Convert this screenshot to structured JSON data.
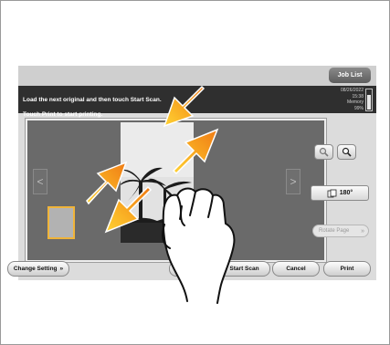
{
  "header": {
    "job_list": "Job List"
  },
  "message": {
    "line1": "Load the next original and then touch Start Scan.",
    "line2": "Touch Print to start printing."
  },
  "status": {
    "date": "08/26/2022",
    "time": "15:38",
    "memory_label": "Memory",
    "memory_value": "99%"
  },
  "preview": {
    "nav_prev": "<",
    "nav_next": ">"
  },
  "side": {
    "zoom_out_icon": "magnifier-minus-icon",
    "zoom_in_icon": "magnifier-plus-icon",
    "rotate_label": "180°",
    "rotate_page_label": "Rotate Page"
  },
  "footer": {
    "change_setting": "Change Setting",
    "start_scan": "Start Scan",
    "cancel": "Cancel",
    "print": "Print"
  },
  "colors": {
    "accent_arrow": "#f39a1e",
    "accent_arrow_light": "#ffd233",
    "thumb_border": "#f0b43a"
  }
}
